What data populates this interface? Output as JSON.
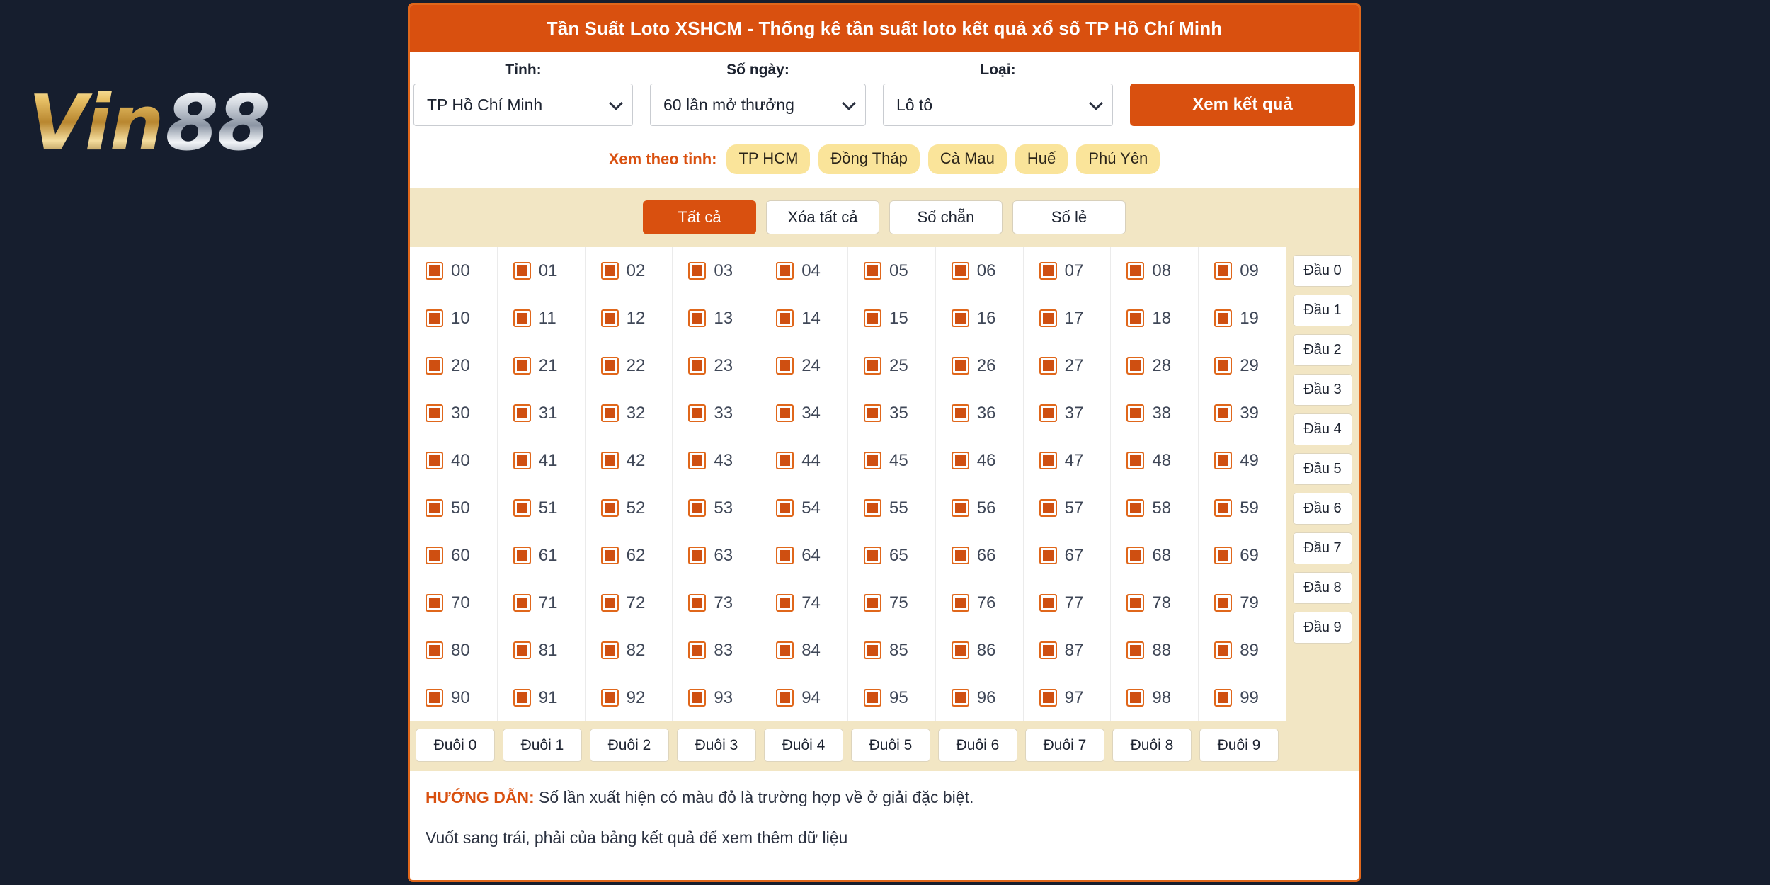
{
  "brand": {
    "part1": "Vin",
    "part2": "88"
  },
  "header": {
    "title": "Tần Suất Loto XSHCM - Thống kê tần suất loto kết quả xổ số TP Hồ Chí Minh"
  },
  "filters": {
    "province": {
      "label": "Tỉnh:",
      "value": "TP Hồ Chí Minh"
    },
    "days": {
      "label": "Số ngày:",
      "value": "60 lần mở thưởng"
    },
    "type": {
      "label": "Loại:",
      "value": "Lô tô"
    },
    "submit_label": "Xem kết quả"
  },
  "province_tags": {
    "label": "Xem theo tỉnh:",
    "items": [
      "TP HCM",
      "Đồng Tháp",
      "Cà Mau",
      "Huế",
      "Phú Yên"
    ]
  },
  "toolbar": {
    "buttons": [
      {
        "label": "Tất cả",
        "active": true
      },
      {
        "label": "Xóa tất cả",
        "active": false
      },
      {
        "label": "Số chẵn",
        "active": false
      },
      {
        "label": "Số lẻ",
        "active": false
      }
    ]
  },
  "grid": {
    "checked": true,
    "numbers": [
      "00",
      "01",
      "02",
      "03",
      "04",
      "05",
      "06",
      "07",
      "08",
      "09",
      "10",
      "11",
      "12",
      "13",
      "14",
      "15",
      "16",
      "17",
      "18",
      "19",
      "20",
      "21",
      "22",
      "23",
      "24",
      "25",
      "26",
      "27",
      "28",
      "29",
      "30",
      "31",
      "32",
      "33",
      "34",
      "35",
      "36",
      "37",
      "38",
      "39",
      "40",
      "41",
      "42",
      "43",
      "44",
      "45",
      "46",
      "47",
      "48",
      "49",
      "50",
      "51",
      "52",
      "53",
      "54",
      "55",
      "56",
      "57",
      "58",
      "59",
      "60",
      "61",
      "62",
      "63",
      "64",
      "65",
      "66",
      "67",
      "68",
      "69",
      "70",
      "71",
      "72",
      "73",
      "74",
      "75",
      "76",
      "77",
      "78",
      "79",
      "80",
      "81",
      "82",
      "83",
      "84",
      "85",
      "86",
      "87",
      "88",
      "89",
      "90",
      "91",
      "92",
      "93",
      "94",
      "95",
      "96",
      "97",
      "98",
      "99"
    ],
    "dau_buttons": [
      "Đầu 0",
      "Đầu 1",
      "Đầu 2",
      "Đầu 3",
      "Đầu 4",
      "Đầu 5",
      "Đầu 6",
      "Đầu 7",
      "Đầu 8",
      "Đầu 9"
    ],
    "duoi_buttons": [
      "Đuôi 0",
      "Đuôi 1",
      "Đuôi 2",
      "Đuôi 3",
      "Đuôi 4",
      "Đuôi 5",
      "Đuôi 6",
      "Đuôi 7",
      "Đuôi 8",
      "Đuôi 9"
    ]
  },
  "guide": {
    "strong": "HƯỚNG DẪN:",
    "line1": " Số lần xuất hiện có màu đỏ là trường hợp về ở giải đặc biệt.",
    "line2": "Vuốt sang trái, phải của bảng kết quả để xem thêm dữ liệu"
  },
  "colors": {
    "page_bg": "#161e2e",
    "accent": "#d9500f",
    "panel_border": "#e0671b",
    "toolbar_bg": "#f2e6c4",
    "tag_bg": "#fae49a"
  }
}
